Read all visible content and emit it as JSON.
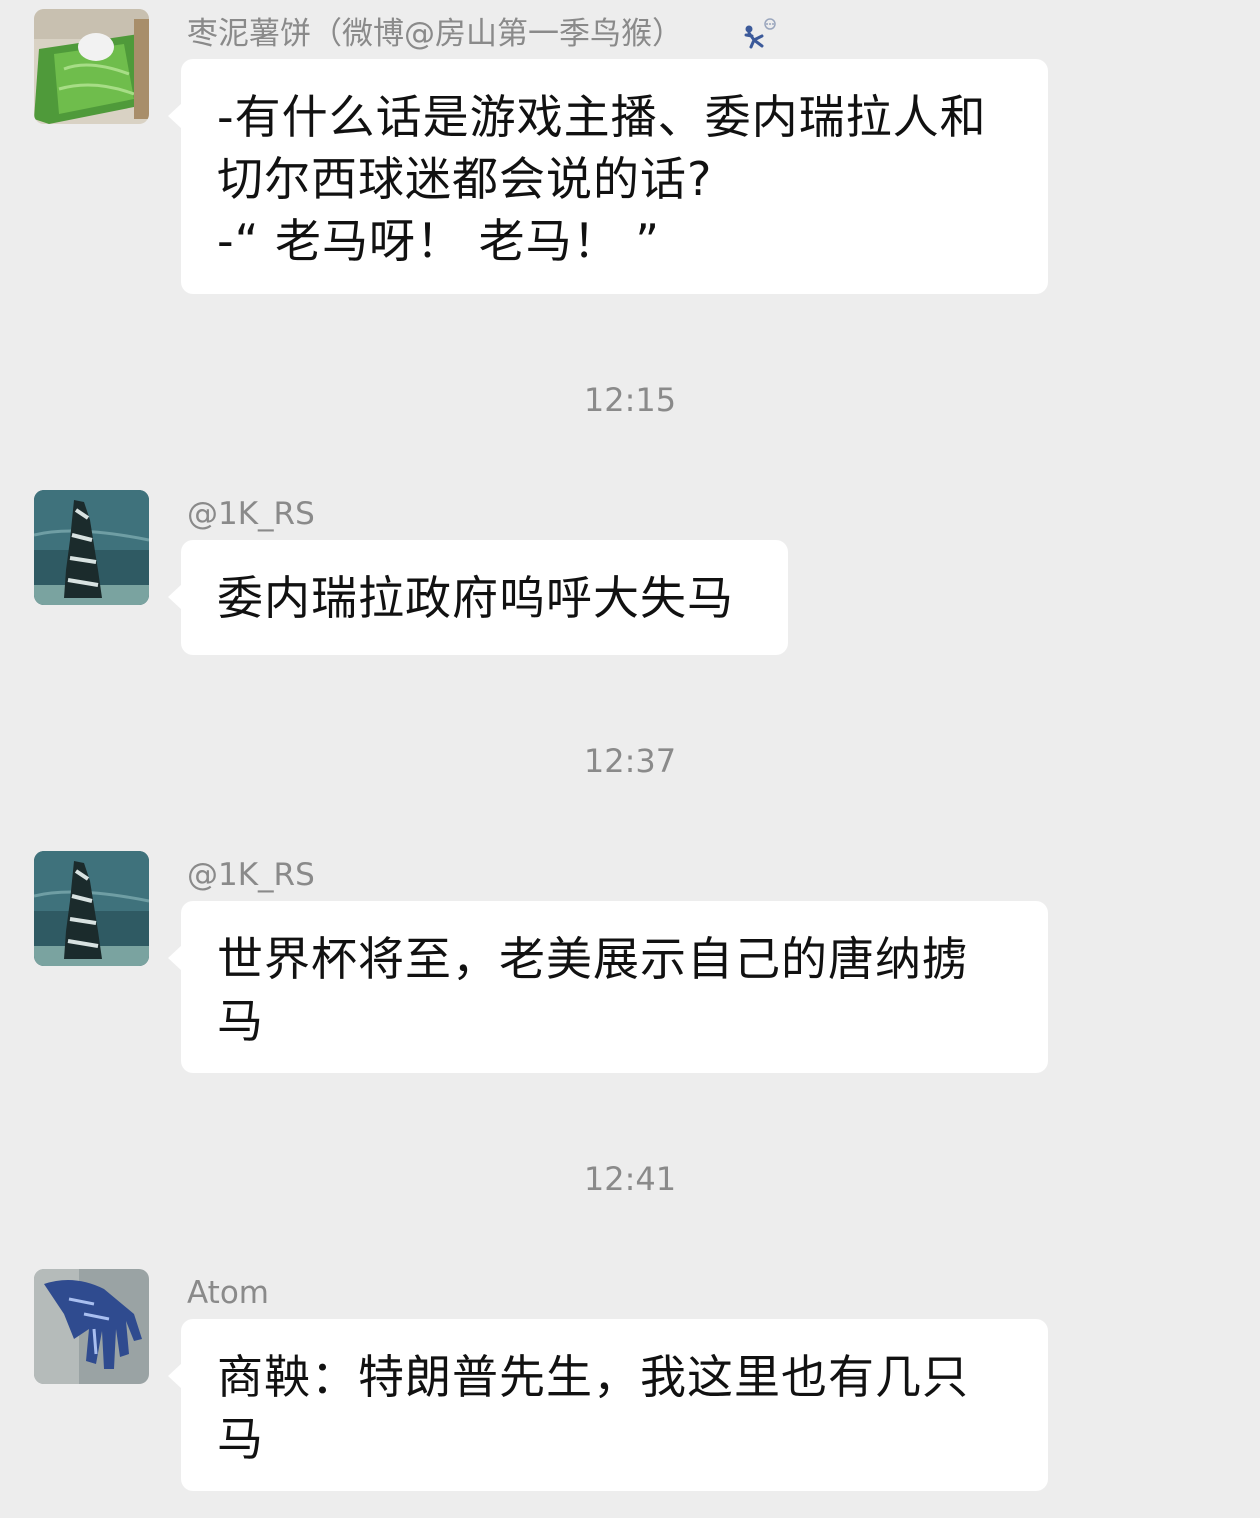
{
  "messages": [
    {
      "sender": "枣泥薯饼（微博@房山第一季鸟猴）",
      "text": "-有什么话是游戏主播、委内瑞拉人和\n切尔西球迷都会说的话?\n-“ 老马呀！ 老马！ ”",
      "avatar_icon": "cabbage-bed-avatar"
    },
    {
      "sender": "@1K_RS",
      "text": "委内瑞拉政府呜呼大失马",
      "avatar_icon": "snowy-tree-avatar"
    },
    {
      "sender": "@1K_RS",
      "text": "世界杯将至，老美展示自己的唐纳掳\n马",
      "avatar_icon": "snowy-tree-avatar"
    },
    {
      "sender": "Atom",
      "text": "商鞅：特朗普先生，我这里也有几只\n马",
      "avatar_icon": "blue-hand-avatar"
    }
  ],
  "timestamps": [
    "12:15",
    "12:37",
    "12:41"
  ],
  "sender_badge_icon": "running-figure-badge-icon",
  "colors": {
    "background": "#ededed",
    "bubble": "#ffffff",
    "meta_text": "#8a8a8a",
    "message_text": "#111111"
  }
}
